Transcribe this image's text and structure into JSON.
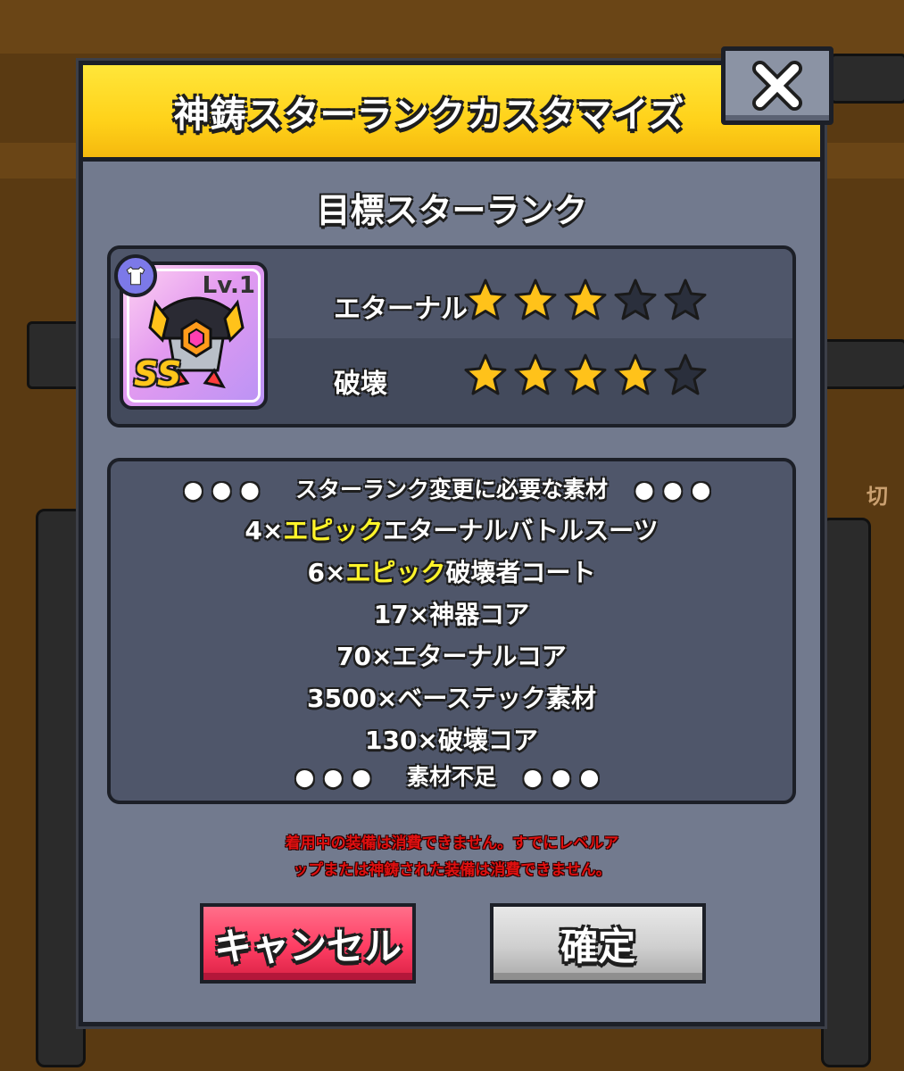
{
  "dialog": {
    "title": "神鋳スターランクカスタマイズ",
    "close_icon": "close-icon"
  },
  "target": {
    "title": "目標スターランク",
    "item": {
      "level": "Lv.1",
      "grade": "SS",
      "type_icon": "shirt-icon",
      "image_icon": "armor-icon"
    },
    "ranks": [
      {
        "label": "エターナル",
        "filled": 3,
        "total": 5
      },
      {
        "label": "破壊",
        "filled": 4,
        "total": 5
      }
    ]
  },
  "materials": {
    "header": "スターランク変更に必要な素材",
    "items": [
      {
        "prefix": "4×",
        "highlight": "エピック",
        "suffix": "エターナルバトルスーツ"
      },
      {
        "prefix": "6×",
        "highlight": "エピック",
        "suffix": "破壊者コート"
      },
      {
        "prefix": "17×神器コア",
        "highlight": "",
        "suffix": ""
      },
      {
        "prefix": "70×エターナルコア",
        "highlight": "",
        "suffix": ""
      },
      {
        "prefix": "3500×ベーステック素材",
        "highlight": "",
        "suffix": ""
      },
      {
        "prefix": "130×破壊コア",
        "highlight": "",
        "suffix": ""
      }
    ],
    "footer": "素材不足",
    "highlight_color": "#fff42a"
  },
  "warning": {
    "line1": "着用中の装備は消費できません。すでにレベルア",
    "line2": "ップまたは神鋳された装備は消費できません。"
  },
  "buttons": {
    "cancel": "キャンセル",
    "confirm": "確定"
  },
  "background": {
    "side_text": "切"
  },
  "colors": {
    "header_yellow": "#ffd21a",
    "cancel_pink": "#ff3d63",
    "star_gold": "#ffc21a",
    "star_empty": "#2a2f3c",
    "warning_red": "#e01010"
  }
}
